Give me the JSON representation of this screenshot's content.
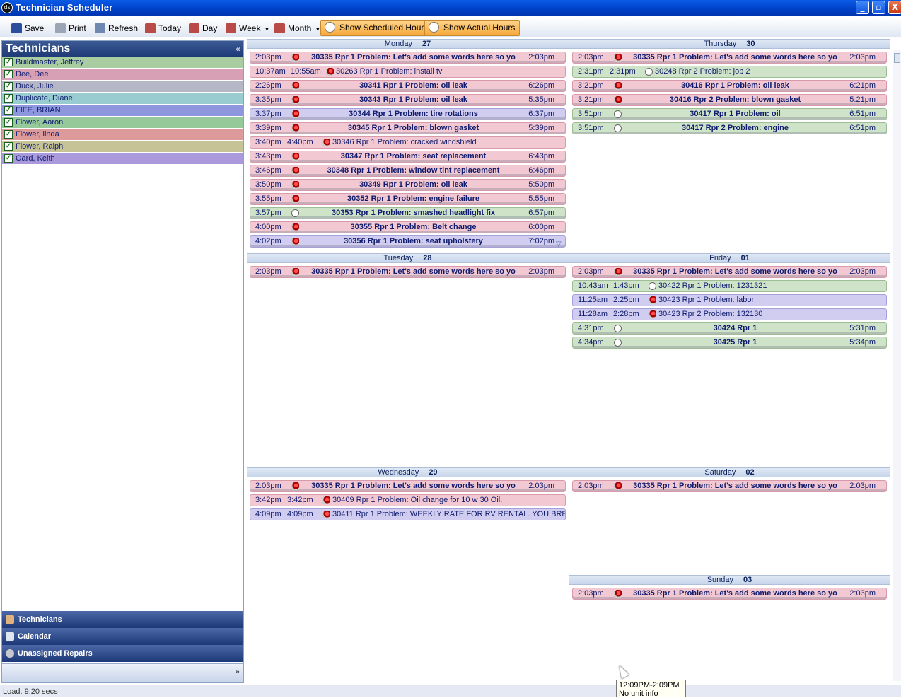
{
  "window": {
    "logo": "ds",
    "title": "Technician Scheduler",
    "min": "_",
    "max": "▫",
    "close": "X"
  },
  "toolbar": {
    "save": "Save",
    "print": "Print",
    "refresh": "Refresh",
    "today": "Today",
    "day": "Day",
    "week": "Week",
    "month": "Month",
    "show_scheduled": "Show Scheduled Hours",
    "show_actual": "Show Actual Hours"
  },
  "colors": {
    "pink": "#f2c9d2",
    "green": "#cfe3c8",
    "purple": "#d1cdf0",
    "accent": "#f6a83a"
  },
  "technicians_panel": {
    "title": "Technicians",
    "collapse": "«",
    "items": [
      {
        "name": "Buildmaster, Jeffrey",
        "color": "#a9cda0"
      },
      {
        "name": "Dee, Dee",
        "color": "#d8a0b4"
      },
      {
        "name": "Duck, Julie",
        "color": "#b5b6c6"
      },
      {
        "name": "Duplicate, Diane",
        "color": "#98ccd0"
      },
      {
        "name": "FIFE, BRIAN",
        "color": "#8e96dd"
      },
      {
        "name": "Flower, Aaron",
        "color": "#96c99a"
      },
      {
        "name": "Flower, linda",
        "color": "#dc9a9a"
      },
      {
        "name": "Flower, Ralph",
        "color": "#c6c497"
      },
      {
        "name": "Oard, Keith",
        "color": "#aa9adc"
      }
    ]
  },
  "nav": {
    "grip": "........",
    "technicians": "Technicians",
    "calendar": "Calendar",
    "unassigned": "Unassigned Repairs",
    "more": "»"
  },
  "days": {
    "mon": {
      "name": "Monday",
      "num": "27"
    },
    "tue": {
      "name": "Tuesday",
      "num": "28"
    },
    "wed": {
      "name": "Wednesday",
      "num": "29"
    },
    "thu": {
      "name": "Thursday",
      "num": "30"
    },
    "fri": {
      "name": "Friday",
      "num": "01"
    },
    "sat": {
      "name": "Saturday",
      "num": "02"
    },
    "sun": {
      "name": "Sunday",
      "num": "03"
    }
  },
  "appointments": {
    "mon": [
      {
        "kind": "b",
        "color": "pink",
        "icon": "rep",
        "start": "2:03pm",
        "title": "30335 Rpr 1 Problem: Let's add some words here so yo",
        "end": "2:03pm"
      },
      {
        "kind": "s",
        "color": "pink",
        "icon": "rep",
        "start": "10:37am",
        "end": "10:55am",
        "title": "30263 Rpr 1 Problem: install tv"
      },
      {
        "kind": "b",
        "color": "pink",
        "icon": "rep",
        "start": "2:26pm",
        "title": "30341 Rpr 1 Problem: oil leak",
        "end": "6:26pm"
      },
      {
        "kind": "b",
        "color": "pink",
        "icon": "rep",
        "start": "3:35pm",
        "title": "30343 Rpr 1 Problem: oil leak",
        "end": "5:35pm"
      },
      {
        "kind": "b",
        "color": "purple",
        "icon": "rep",
        "start": "3:37pm",
        "title": "30344 Rpr 1 Problem: tire rotations",
        "end": "6:37pm"
      },
      {
        "kind": "b",
        "color": "pink",
        "icon": "rep",
        "start": "3:39pm",
        "title": "30345 Rpr 1 Problem: blown gasket",
        "end": "5:39pm"
      },
      {
        "kind": "s",
        "color": "pink",
        "icon": "rep",
        "start": "3:40pm",
        "end": "4:40pm",
        "title": "30346 Rpr 1 Problem: cracked windshield"
      },
      {
        "kind": "b",
        "color": "pink",
        "icon": "rep",
        "start": "3:43pm",
        "title": "30347 Rpr 1 Problem: seat replacement",
        "end": "6:43pm"
      },
      {
        "kind": "b",
        "color": "pink",
        "icon": "rep",
        "start": "3:46pm",
        "title": "30348 Rpr 1 Problem: window tint replacement",
        "end": "6:46pm"
      },
      {
        "kind": "b",
        "color": "pink",
        "icon": "rep",
        "start": "3:50pm",
        "title": "30349 Rpr 1 Problem: oil leak",
        "end": "5:50pm"
      },
      {
        "kind": "b",
        "color": "pink",
        "icon": "rep",
        "start": "3:55pm",
        "title": "30352 Rpr 1 Problem: engine failure",
        "end": "5:55pm"
      },
      {
        "kind": "b",
        "color": "green",
        "icon": "circ",
        "start": "3:57pm",
        "title": "30353 Rpr 1 Problem: smashed headlight fix",
        "end": "6:57pm"
      },
      {
        "kind": "b",
        "color": "pink",
        "icon": "rep",
        "start": "4:00pm",
        "title": "30355 Rpr 1 Problem: Belt change",
        "end": "6:00pm"
      },
      {
        "kind": "b",
        "color": "purple",
        "icon": "rep",
        "start": "4:02pm",
        "title": "30356 Rpr 1 Problem: seat upholstery",
        "end": "7:02pm"
      }
    ],
    "tue": [
      {
        "kind": "b",
        "color": "pink",
        "icon": "rep",
        "start": "2:03pm",
        "title": "30335 Rpr 1 Problem: Let's add some words here so yo",
        "end": "2:03pm"
      }
    ],
    "wed": [
      {
        "kind": "b",
        "color": "pink",
        "icon": "rep",
        "start": "2:03pm",
        "title": "30335 Rpr 1 Problem: Let's add some words here so yo",
        "end": "2:03pm"
      },
      {
        "kind": "s",
        "color": "pink",
        "icon": "rep",
        "start": "3:42pm",
        "end": "3:42pm",
        "title": "30409 Rpr 1 Problem: Oil change for 10 w 30 Oil."
      },
      {
        "kind": "s",
        "color": "purple",
        "icon": "rep",
        "start": "4:09pm",
        "end": "4:09pm",
        "title": "30411 Rpr 1 Problem: WEEKLY RATE FOR RV RENTAL.  YOU BRE"
      }
    ],
    "thu": [
      {
        "kind": "b",
        "color": "pink",
        "icon": "rep",
        "start": "2:03pm",
        "title": "30335 Rpr 1 Problem: Let's add some words here so yo",
        "end": "2:03pm"
      },
      {
        "kind": "s",
        "color": "green",
        "icon": "circ",
        "start": "2:31pm",
        "end": "2:31pm",
        "title": "30248 Rpr 2 Problem: job 2"
      },
      {
        "kind": "b",
        "color": "pink",
        "icon": "rep",
        "start": "3:21pm",
        "title": "30416 Rpr 1 Problem: oil leak",
        "end": "6:21pm"
      },
      {
        "kind": "b",
        "color": "pink",
        "icon": "rep",
        "start": "3:21pm",
        "title": "30416 Rpr 2 Problem: blown gasket",
        "end": "5:21pm"
      },
      {
        "kind": "b",
        "color": "green",
        "icon": "circ",
        "start": "3:51pm",
        "title": "30417 Rpr 1 Problem: oil",
        "end": "6:51pm"
      },
      {
        "kind": "b",
        "color": "green",
        "icon": "circ",
        "start": "3:51pm",
        "title": "30417 Rpr 2 Problem: engine",
        "end": "6:51pm"
      }
    ],
    "fri": [
      {
        "kind": "b",
        "color": "pink",
        "icon": "rep",
        "start": "2:03pm",
        "title": "30335 Rpr 1 Problem: Let's add some words here so yo",
        "end": "2:03pm"
      },
      {
        "kind": "s",
        "color": "green",
        "icon": "circ",
        "start": "10:43am",
        "end": "1:43pm",
        "title": "30422 Rpr 1 Problem: 1231321"
      },
      {
        "kind": "s",
        "color": "purple",
        "icon": "rep",
        "start": "11:25am",
        "end": "2:25pm",
        "title": "30423 Rpr 1 Problem: labor"
      },
      {
        "kind": "s",
        "color": "purple",
        "icon": "rep",
        "start": "11:28am",
        "end": "2:28pm",
        "title": "30423 Rpr 2 Problem: 132130"
      },
      {
        "kind": "b",
        "color": "green",
        "icon": "circ",
        "start": "4:31pm",
        "title": "30424 Rpr 1",
        "end": "5:31pm"
      },
      {
        "kind": "b",
        "color": "green",
        "icon": "circ",
        "start": "4:34pm",
        "title": "30425 Rpr 1",
        "end": "5:34pm"
      }
    ],
    "sat": [
      {
        "kind": "b",
        "color": "pink",
        "icon": "rep",
        "start": "2:03pm",
        "title": "30335 Rpr 1 Problem: Let's add some words here so yo",
        "end": "2:03pm"
      }
    ],
    "sun": [
      {
        "kind": "b",
        "color": "pink",
        "icon": "rep",
        "start": "2:03pm",
        "title": "30335 Rpr 1 Problem: Let's add some words here so yo",
        "end": "2:03pm"
      }
    ]
  },
  "more_indicator": "▽",
  "status": {
    "load": "Load: 9.20 secs"
  },
  "tooltip": {
    "line1": "12:09PM-2:09PM",
    "line2": "No unit info"
  }
}
